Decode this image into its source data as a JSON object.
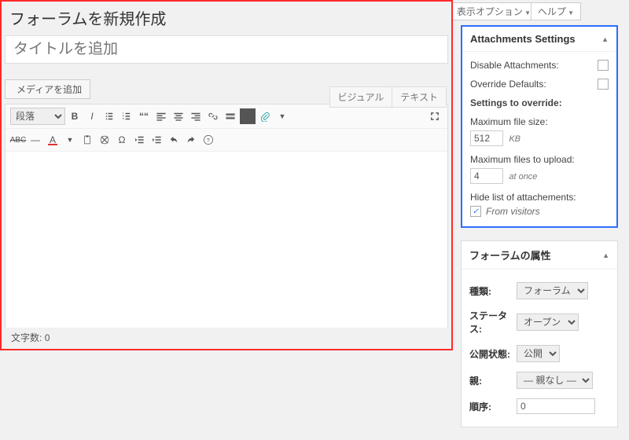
{
  "topbar": {
    "screen_options": "表示オプション",
    "help": "ヘルプ"
  },
  "main": {
    "page_title": "フォーラムを新規作成",
    "title_placeholder": "タイトルを追加",
    "add_media": "メディアを追加",
    "tabs": {
      "visual": "ビジュアル",
      "text": "テキスト"
    },
    "format_select": "段落",
    "word_count_label": "文字数:",
    "word_count_value": "0"
  },
  "attachments": {
    "panel_title": "Attachments Settings",
    "disable_label": "Disable Attachments:",
    "disable_checked": false,
    "override_label": "Override Defaults:",
    "override_checked": false,
    "settings_to_override": "Settings to override:",
    "max_size_label": "Maximum file size:",
    "max_size_value": "512",
    "max_size_unit": "KB",
    "max_files_label": "Maximum files to upload:",
    "max_files_value": "4",
    "max_files_unit": "at once",
    "hide_list_label": "Hide list of attachements:",
    "from_visitors_label": "From visitors",
    "from_visitors_checked": true
  },
  "attributes": {
    "panel_title": "フォーラムの属性",
    "type_label": "種類:",
    "type_value": "フォーラム",
    "status_label": "ステータス:",
    "status_value": "オープン",
    "visibility_label": "公開状態:",
    "visibility_value": "公開",
    "parent_label": "親:",
    "parent_value": "— 親なし —",
    "order_label": "順序:",
    "order_value": "0"
  }
}
